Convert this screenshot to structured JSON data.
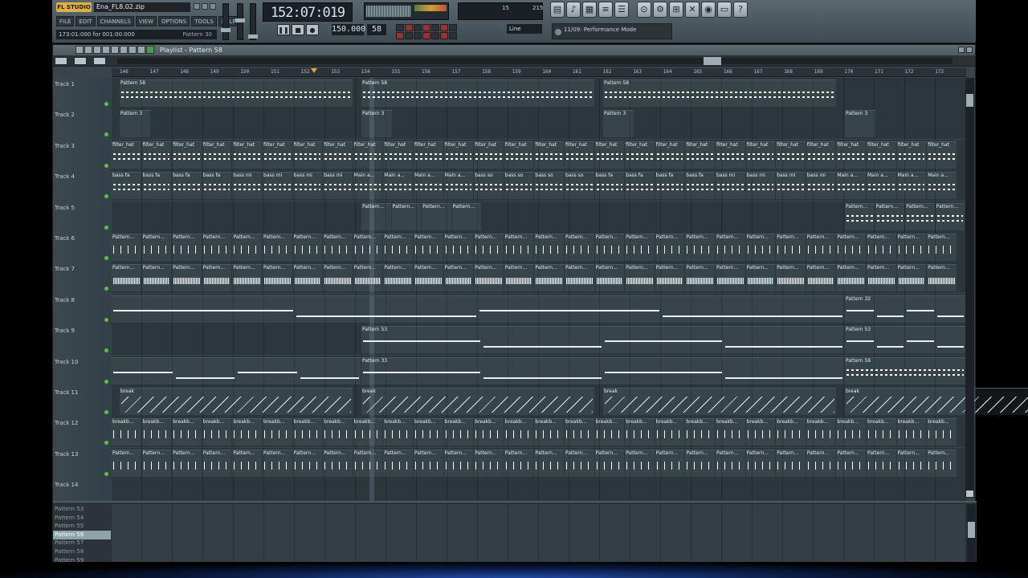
{
  "app": {
    "logo": "FL STUDIO",
    "file": "Ena_FL8.02.zip"
  },
  "menu": [
    "FILE",
    "EDIT",
    "CHANNELS",
    "VIEW",
    "OPTIONS",
    "TOOLS",
    "HELP"
  ],
  "hint": {
    "text": "173:01:000 for 001:00:000",
    "pattern": "Pattern 30"
  },
  "transport": {
    "time": "152:07:019",
    "tempo": "150.000",
    "pattern": "58",
    "snap": "Line"
  },
  "cpu": {
    "cpu": "15",
    "poly": "215"
  },
  "hint_line": "11/09: Performance Mode",
  "playlist": {
    "title": "Playlist - Pattern 58"
  },
  "ruler": [
    "146",
    "147",
    "148",
    "149",
    "150",
    "151",
    "152",
    "153",
    "154",
    "155",
    "156",
    "157",
    "158",
    "159",
    "160",
    "161",
    "162",
    "163",
    "164",
    "165",
    "166",
    "167",
    "168",
    "169",
    "170",
    "171",
    "172",
    "173"
  ],
  "tracks": [
    {
      "label": "Track 1",
      "clips": [
        "Pattern 58",
        "Pattern 58",
        "Pattern 58"
      ]
    },
    {
      "label": "Track 2",
      "clips": [
        "Pattern 3",
        "Pattern 3",
        "Pattern 3",
        "Pattern 3"
      ]
    },
    {
      "label": "Track 3",
      "clip_name": "filter_hat"
    },
    {
      "label": "Track 4",
      "clips": [
        "bass fa",
        "bass fa",
        "bass fa",
        "bass fa",
        "bass mi",
        "bass mi",
        "bass mi",
        "bass mi",
        "Main a...",
        "Main a...",
        "Main a...",
        "Main a...",
        "bass so",
        "bass so",
        "bass so",
        "bass so",
        "bass fa",
        "bass fa",
        "bass fa",
        "bass fa",
        "bass mi",
        "bass mi",
        "bass mi",
        "bass mi",
        "Main a...",
        "Main a...",
        "Main a...",
        "Main a..."
      ]
    },
    {
      "label": "Track 5",
      "clip_name": "Pattern..."
    },
    {
      "label": "Track 6",
      "clip_name": "Pattern..."
    },
    {
      "label": "Track 7",
      "clip_name": "Pattern..."
    },
    {
      "label": "Track 8",
      "clips": [
        "Pattern 32"
      ]
    },
    {
      "label": "Track 9",
      "clips": [
        "Pattern 53",
        "Pattern 53"
      ]
    },
    {
      "label": "Track 10",
      "clips": [
        "Pattern 33",
        "Pattern 59"
      ]
    },
    {
      "label": "Track 11",
      "clips": [
        "break",
        "break",
        "break",
        "break"
      ]
    },
    {
      "label": "Track 12",
      "clip_name": "breakb..."
    },
    {
      "label": "Track 13",
      "clip_name": "Pattern..."
    },
    {
      "label": "Track 14",
      "clips": []
    }
  ],
  "pattern_list": [
    "Pattern 53",
    "Pattern 54",
    "Pattern 55",
    "Pattern 56",
    "Pattern 57",
    "Pattern 58",
    "Pattern 59"
  ],
  "pattern_selected": "Pattern 56"
}
